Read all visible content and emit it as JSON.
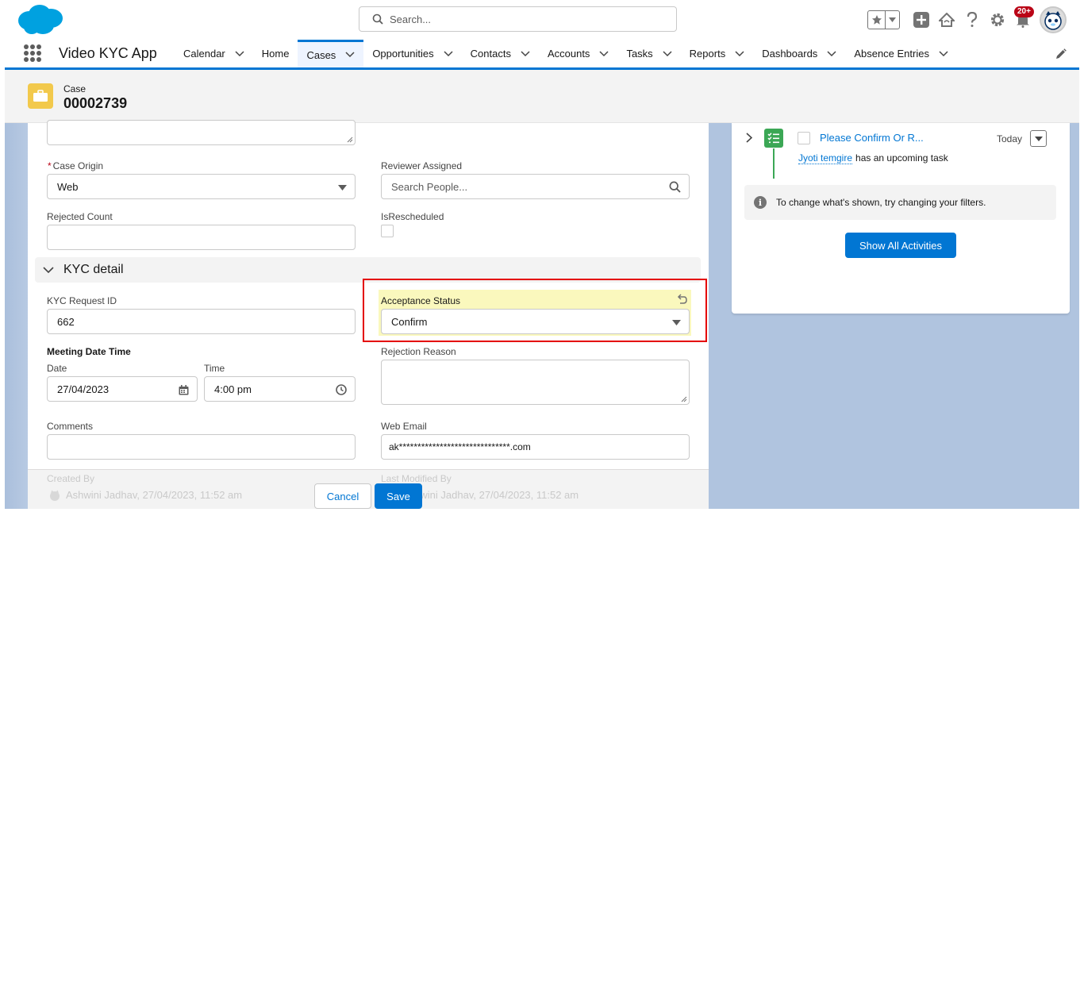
{
  "header": {
    "search_placeholder": "Search...",
    "notification_count": "20+"
  },
  "nav": {
    "app_name": "Video KYC App",
    "items": [
      {
        "label": "Calendar",
        "has_menu": true
      },
      {
        "label": "Home",
        "has_menu": false
      },
      {
        "label": "Cases",
        "has_menu": true,
        "active": true
      },
      {
        "label": "Opportunities",
        "has_menu": true
      },
      {
        "label": "Contacts",
        "has_menu": true
      },
      {
        "label": "Accounts",
        "has_menu": true
      },
      {
        "label": "Tasks",
        "has_menu": true
      },
      {
        "label": "Reports",
        "has_menu": true
      },
      {
        "label": "Dashboards",
        "has_menu": true
      },
      {
        "label": "Absence Entries",
        "has_menu": true
      }
    ]
  },
  "record": {
    "object_label": "Case",
    "number": "00002739"
  },
  "form": {
    "case_origin": {
      "label": "Case Origin",
      "required_mark": "*",
      "value": "Web"
    },
    "reviewer_assigned": {
      "label": "Reviewer Assigned",
      "placeholder": "Search People..."
    },
    "rejected_count": {
      "label": "Rejected Count",
      "value": ""
    },
    "is_rescheduled": {
      "label": "IsRescheduled"
    },
    "section_kyc": "KYC detail",
    "kyc_request_id": {
      "label": "KYC Request ID",
      "value": "662"
    },
    "acceptance_status": {
      "label": "Acceptance Status",
      "value": "Confirm"
    },
    "meeting_date_time": "Meeting Date Time",
    "date": {
      "label": "Date",
      "value": "27/04/2023"
    },
    "time": {
      "label": "Time",
      "value": "4:00 pm"
    },
    "rejection_reason": {
      "label": "Rejection Reason"
    },
    "comments": {
      "label": "Comments",
      "value": ""
    },
    "web_email": {
      "label": "Web Email",
      "value": "ak******************************.com"
    }
  },
  "footer": {
    "created_by_label": "Created By",
    "created_by_value": "Ashwini Jadhav, 27/04/2023, 11:52 am",
    "last_modified_label": "Last Modified By",
    "last_modified_value": "Ashwini Jadhav, 27/04/2023, 11:52 am",
    "cancel_label": "Cancel",
    "save_label": "Save"
  },
  "activity": {
    "task_title": "Please Confirm Or R...",
    "task_date": "Today",
    "assignee": "Jyoti temgire",
    "assignee_text": "has an upcoming task",
    "filter_info": "To change what's shown, try changing your filters.",
    "show_all_label": "Show All Activities"
  },
  "colors": {
    "brand": "#0176d3",
    "nav_active_bg": "#eef4ff",
    "case_icon": "#f2c94c",
    "task_icon": "#3ba755",
    "highlight": "#e40000",
    "changed_field": "#faf8bd"
  }
}
